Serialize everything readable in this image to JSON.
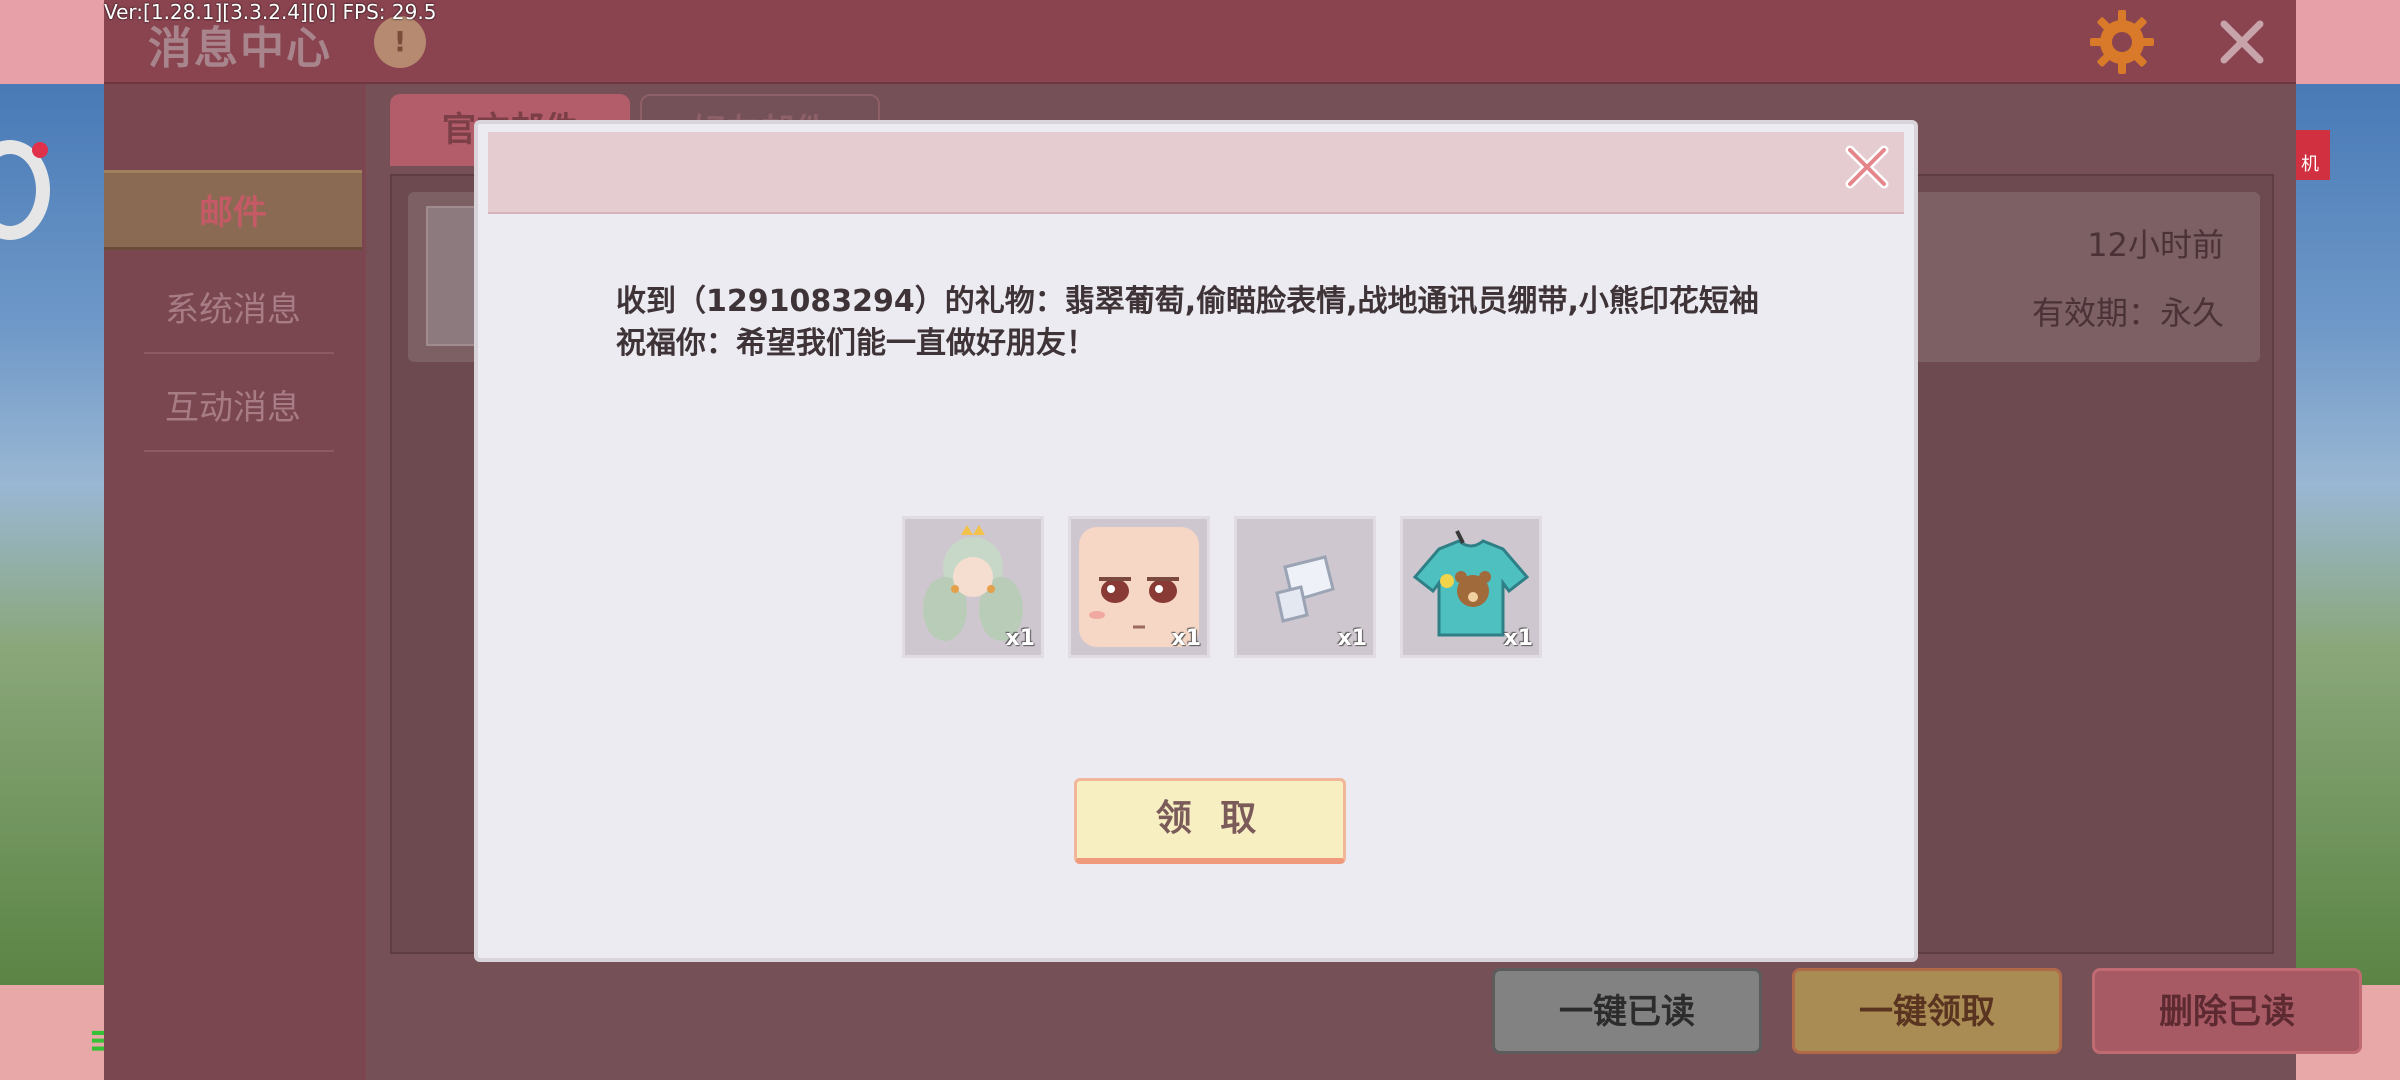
{
  "debug": {
    "text": "Ver:[1.28.1][3.3.2.4][0] FPS: 29.5"
  },
  "window": {
    "title": "消息中心"
  },
  "background": {
    "right_badge": "机",
    "left_green": "≡"
  },
  "sidebar": {
    "items": [
      {
        "label": "邮件",
        "active": true
      },
      {
        "label": "系统消息",
        "active": false
      },
      {
        "label": "互动消息",
        "active": false
      }
    ]
  },
  "tabs": [
    {
      "label": "官方邮件"
    },
    {
      "label": "好友邮件"
    }
  ],
  "mail_item": {
    "time": "12小时前",
    "expiry": "有效期：永久"
  },
  "bottom_buttons": {
    "read_all": "一键已读",
    "claim_all": "一键领取",
    "delete_read": "删除已读"
  },
  "modal": {
    "gift_text": "收到（1291083294）的礼物：翡翠葡萄,偷瞄脸表情,战地通讯员绷带,小熊印花短袖",
    "blessing_text": "祝福你：希望我们能一直做好朋友！",
    "items": [
      {
        "icon": "hair-icon",
        "qty": "x1"
      },
      {
        "icon": "face-icon",
        "qty": "x1"
      },
      {
        "icon": "bandage-icon",
        "qty": "x1"
      },
      {
        "icon": "tshirt-icon",
        "qty": "x1"
      }
    ],
    "claim_label": "领 取"
  },
  "colors": {
    "window_bg": "#7e4650",
    "modal_bg": "#ecebf2",
    "modal_header": "#e5ccd0",
    "claim_button": "#f7eec2"
  }
}
